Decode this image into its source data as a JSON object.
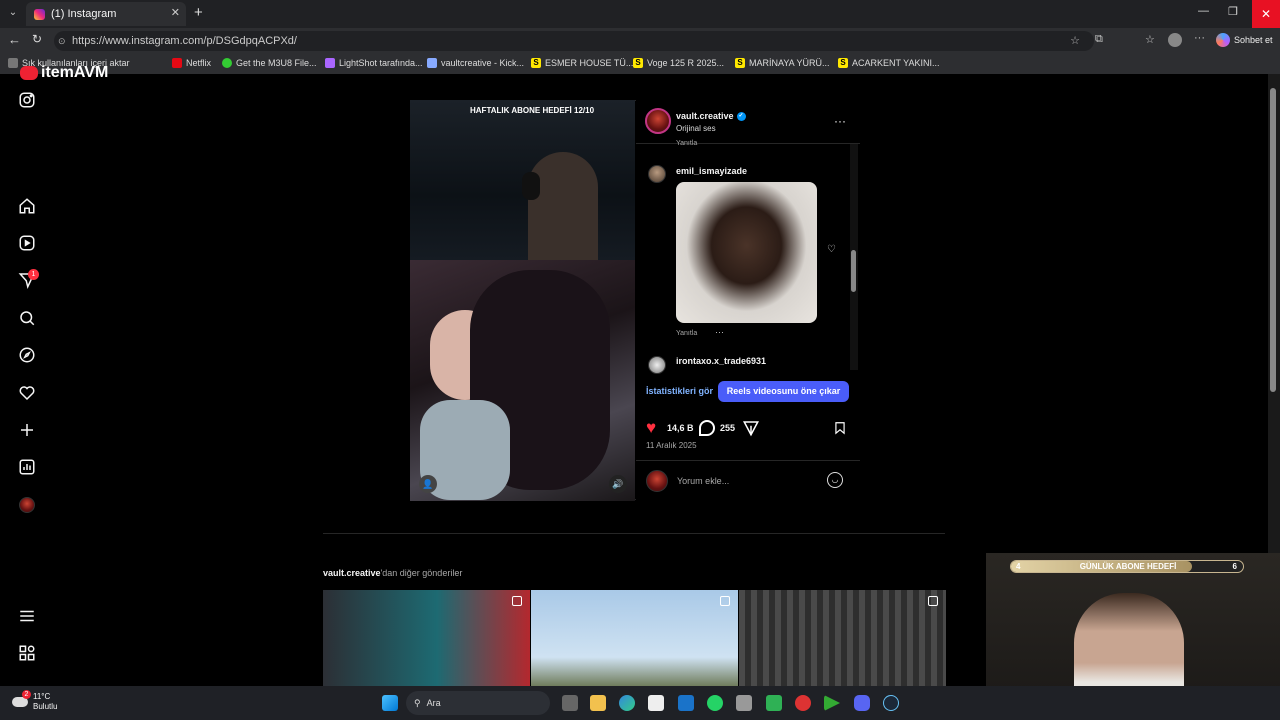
{
  "browser": {
    "tab_title": "(1) Instagram",
    "url": "https://www.instagram.com/p/DSGdpqACPXd/",
    "copilot_label": "Sohbet et",
    "bookmarks": [
      {
        "label": "Sık kullanılanları içeri aktar"
      },
      {
        "label": "Netflix"
      },
      {
        "label": "Get the M3U8 File..."
      },
      {
        "label": "LightShot tarafında..."
      },
      {
        "label": "vaultcreative - Kick..."
      },
      {
        "label": "ESMER HOUSE TÜ..."
      },
      {
        "label": "Voge 125 R 2025..."
      },
      {
        "label": "MARİNAYA YÜRÜ..."
      },
      {
        "label": "ACARKENT YAKINI..."
      }
    ]
  },
  "overlay": {
    "logo_text": "itemAVM",
    "stream_header": "HAFTALIK ABONE HEDEFİ 12/10",
    "goal_label": "GÜNLÜK ABONE HEDEFİ",
    "goal_left": "4",
    "goal_right": "6",
    "goal_progress": 0.78
  },
  "nav": {
    "notification_badge": "1"
  },
  "post": {
    "author": "vault.creative",
    "audio": "Orijinal ses",
    "reply_label_top": "Yanıtla",
    "comment1_user": "emil_ismayizade",
    "comment1_reply": "Yanıtla",
    "comment2_user": "irontaxo.x_trade6931",
    "insights_label": "İstatistikleri gör",
    "boost_label": "Reels videosunu öne çıkar",
    "likes": "14,6 B",
    "comments": "255",
    "date": "11 Aralık 2025",
    "comment_placeholder": "Yorum ekle..."
  },
  "more": {
    "author": "vault.creative",
    "suffix": "'dan diğer gönderiler"
  },
  "taskbar": {
    "weather_temp": "11°C",
    "weather_desc": "Bulutlu",
    "search_label": "Ara",
    "weather_badge": "2"
  }
}
